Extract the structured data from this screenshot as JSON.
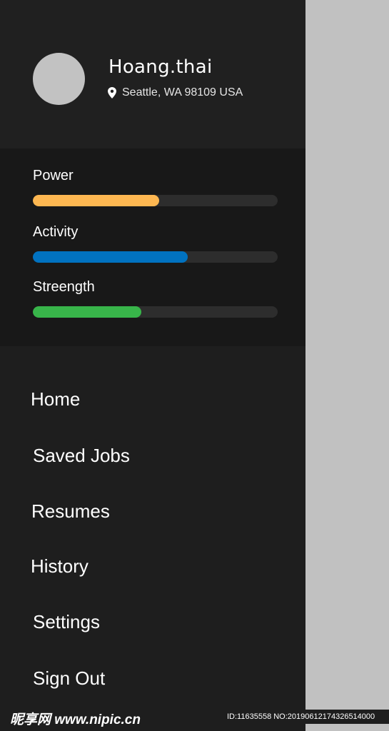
{
  "profile": {
    "username": "Hoang.thai",
    "location": "Seattle, WA 98109 USA",
    "location_icon": "map-pin-icon",
    "avatar_icon": "avatar-placeholder"
  },
  "stats": [
    {
      "label": "Power",
      "value": 0.515,
      "color": "#fdb751"
    },
    {
      "label": "Activity",
      "value": 0.633,
      "color": "#0172c0"
    },
    {
      "label": "Streength",
      "value": 0.443,
      "color": "#38b54a"
    }
  ],
  "menu": [
    {
      "label": "Home"
    },
    {
      "label": "Saved Jobs"
    },
    {
      "label": "Resumes"
    },
    {
      "label": "History"
    },
    {
      "label": "Settings"
    },
    {
      "label": "Sign Out"
    }
  ],
  "watermark": {
    "left": "昵享网 www.nipic.cn",
    "right": "ID:11635558 NO:20190612174326514000"
  }
}
